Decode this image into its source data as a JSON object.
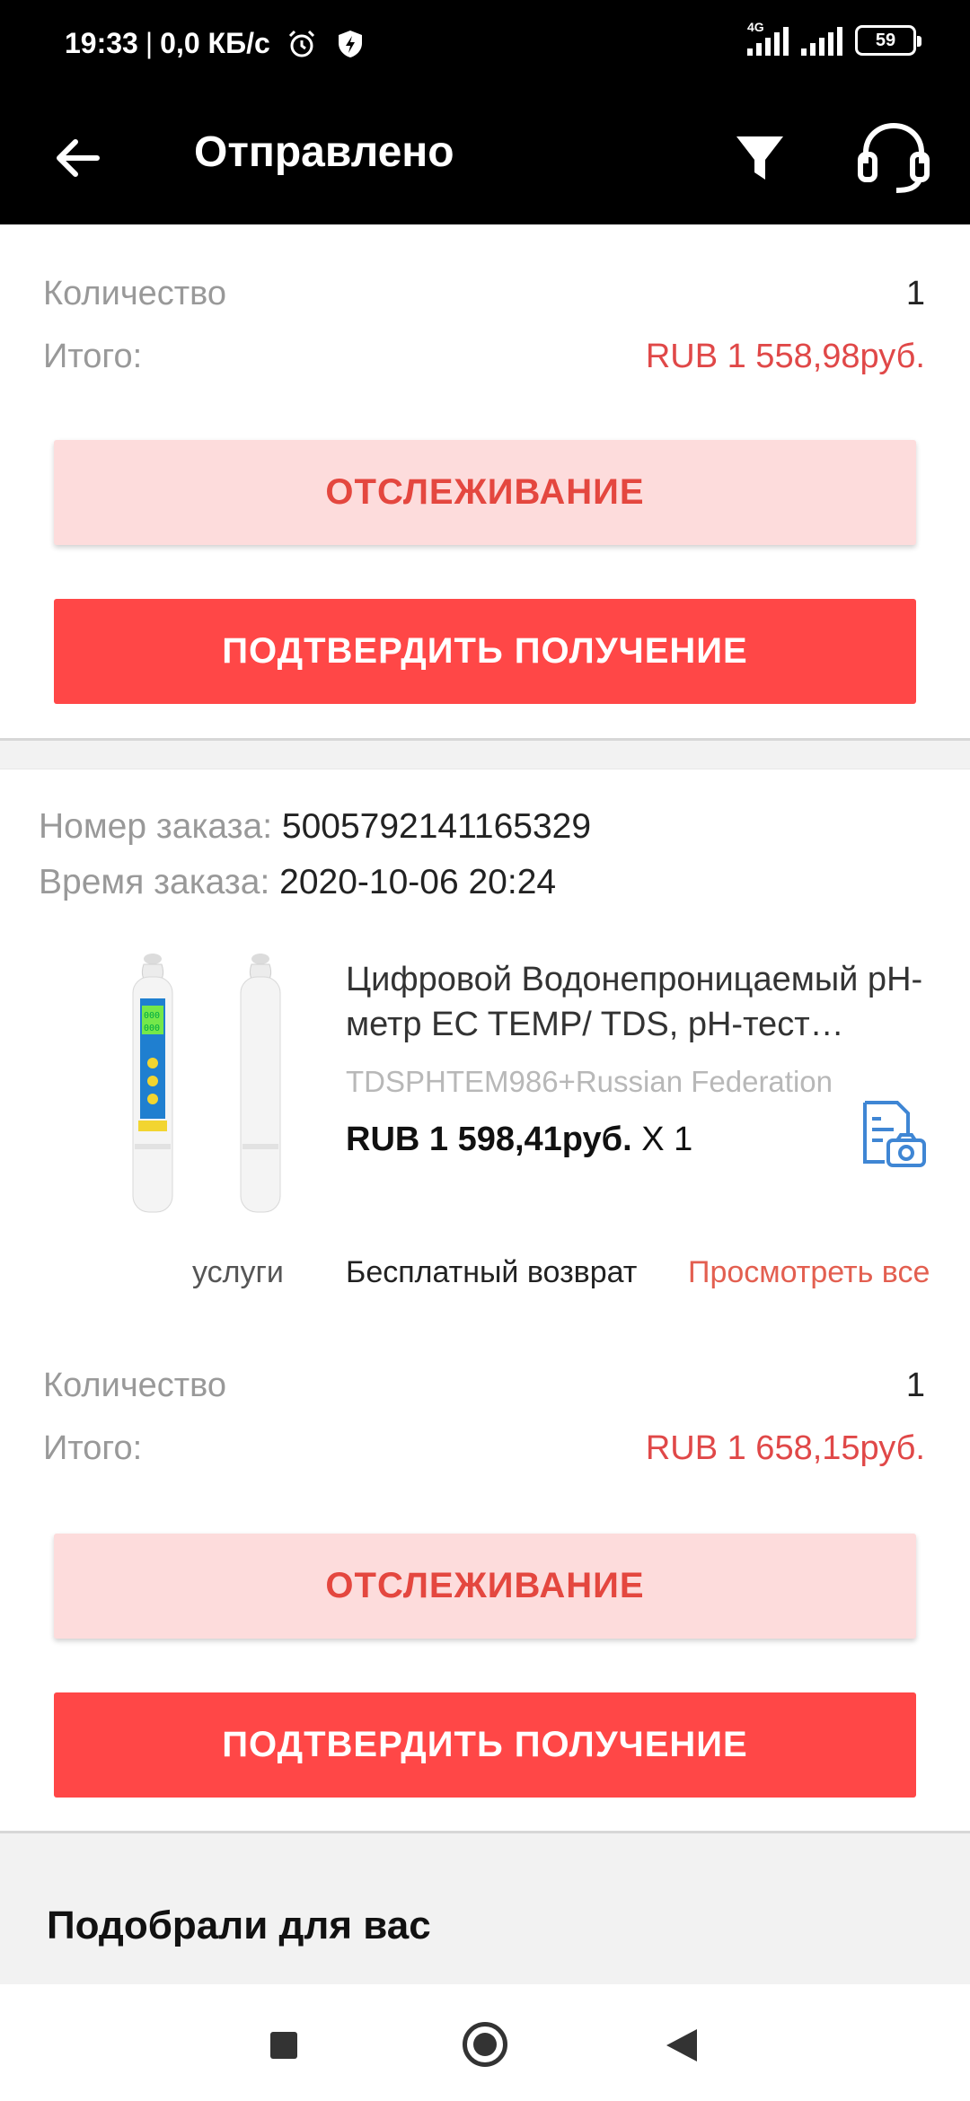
{
  "status_bar": {
    "time": "19:33",
    "speed": "0,0 КБ/с",
    "network": "4G",
    "battery": "59"
  },
  "app_bar": {
    "title": "Отправлено"
  },
  "order1": {
    "quantity_label": "Количество",
    "quantity_value": "1",
    "total_label": "Итого:",
    "total_value": "RUB 1 558,98руб.",
    "track_label": "ОТСЛЕЖИВАНИЕ",
    "confirm_label": "ПОДТВЕРДИТЬ ПОЛУЧЕНИЕ"
  },
  "order2": {
    "order_number_label": "Номер заказа:",
    "order_number": "5005792141165329",
    "order_time_label": "Время заказа:",
    "order_time": "2020-10-06 20:24",
    "product": {
      "title": "Цифровой Водонепроницаемый pH-метр EC TEMP/ TDS, pH-тест…",
      "sku": "TDSPHTEM986+Russian Federation",
      "price": "RUB 1 598,41руб.",
      "qty": "X 1"
    },
    "services_label": "услуги",
    "free_return": "Бесплатный возврат",
    "view_all": "Просмотреть все",
    "quantity_label": "Количество",
    "quantity_value": "1",
    "total_label": "Итого:",
    "total_value": "RUB 1 658,15руб.",
    "track_label": "ОТСЛЕЖИВАНИЕ",
    "confirm_label": "ПОДТВЕРДИТЬ ПОЛУЧЕНИЕ"
  },
  "recommend_title": "Подобрали для вас",
  "colors": {
    "accent_red": "#ff4747",
    "price_red": "#e04848",
    "track_bg": "#fddcdc",
    "icon_blue": "#3f86d4"
  }
}
